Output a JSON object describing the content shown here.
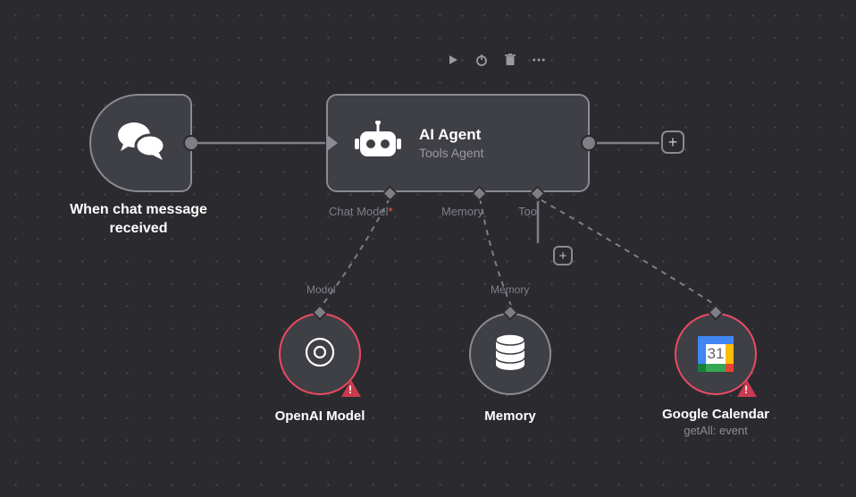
{
  "toolbar": {
    "play": "play-icon",
    "power": "power-icon",
    "trash": "trash-icon",
    "more": "more-icon"
  },
  "trigger": {
    "label": "When chat message received"
  },
  "agent": {
    "title": "AI Agent",
    "subtitle": "Tools Agent",
    "ports": {
      "chat_model": "Chat Model",
      "chat_model_required": "*",
      "memory": "Memory",
      "tool": "Tool"
    }
  },
  "nodes": {
    "openai": {
      "label": "OpenAI Model",
      "port_label": "Model",
      "has_error": true
    },
    "memory": {
      "label": "Memory",
      "port_label": "Memory",
      "has_error": false
    },
    "gcal": {
      "label": "Google Calendar",
      "sublabel": "getAll: event",
      "calendar_day": "31",
      "has_error": true
    }
  }
}
